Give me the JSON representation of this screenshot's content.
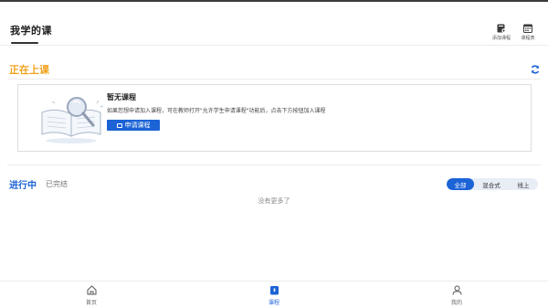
{
  "header": {
    "title": "我学的课",
    "add_course_label": "添加课程",
    "schedule_label": "课程表"
  },
  "live": {
    "title": "正在上课",
    "empty_title": "暂无课程",
    "empty_hint": "如果您想申请加入课程，可在教师打开\"允许学生申请课程\"功能后，点击下方按钮加入课程",
    "apply_label": "申请课程"
  },
  "courses": {
    "tab_ongoing": "进行中",
    "tab_finished": "已完结",
    "filters": [
      "全部",
      "混合式",
      "线上"
    ],
    "selected_filter": "全部",
    "no_more_text": "没有更多了"
  },
  "bottom_nav": {
    "items": [
      {
        "label": "首页",
        "active": false
      },
      {
        "label": "课程",
        "active": true
      },
      {
        "label": "我的",
        "active": false
      }
    ]
  },
  "colors": {
    "accent": "#1c63d6",
    "live_title": "#f0a21b"
  }
}
